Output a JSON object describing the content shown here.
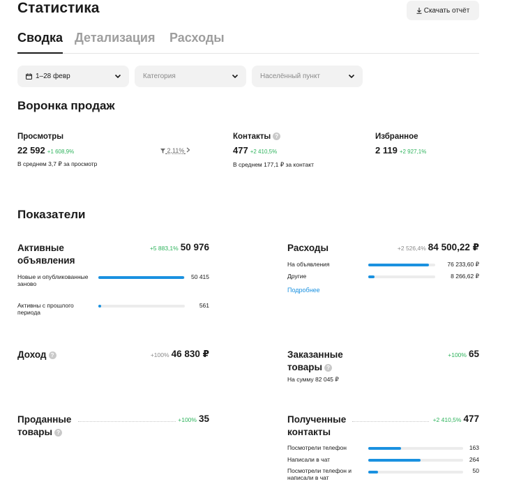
{
  "header": {
    "title": "Статистика",
    "download_label": "Скачать отчёт"
  },
  "tabs": [
    {
      "label": "Сводка",
      "active": true
    },
    {
      "label": "Детализация",
      "active": false
    },
    {
      "label": "Расходы",
      "active": false
    }
  ],
  "filters": {
    "period": "1–28 февр",
    "category_placeholder": "Категория",
    "locality_placeholder": "Населённый пункт"
  },
  "funnel": {
    "title": "Воронка продаж",
    "views": {
      "label": "Просмотры",
      "value": "22 592",
      "delta": "+1 608,9%",
      "sub": "В среднем 3,7 ₽ за просмотр"
    },
    "conversion": "2,11%",
    "contacts": {
      "label": "Контакты",
      "value": "477",
      "delta": "+2 410,5%",
      "sub": "В среднем 177,1 ₽ за контакт"
    },
    "favorites": {
      "label": "Избранное",
      "value": "2 119",
      "delta": "+2 927,1%"
    }
  },
  "indicators": {
    "title": "Показатели",
    "active_ads": {
      "title": "Активные объявления",
      "pct": "+5 883,1%",
      "value": "50 976",
      "rows": [
        {
          "label": "Новые и опубликованные заново",
          "value": "50 415",
          "fraction": 0.989
        },
        {
          "label": "Активны с прошлого периода",
          "value": "561",
          "fraction": 0.011
        }
      ]
    },
    "expenses": {
      "title": "Расходы",
      "pct": "+2 526,4%",
      "value": "84 500,22 ₽",
      "rows": [
        {
          "label": "На объявления",
          "value": "76 233,60 ₽",
          "fraction": 0.902
        },
        {
          "label": "Другие",
          "value": "8 266,62 ₽",
          "fraction": 0.098
        }
      ],
      "more_link": "Подробнее"
    },
    "income": {
      "title": "Доход",
      "pct": "+100%",
      "value": "46 830 ₽"
    },
    "ordered": {
      "title": "Заказанные товары",
      "pct": "+100%",
      "value": "65",
      "note": "На сумму 82 045 ₽"
    },
    "sold": {
      "title": "Проданные товары",
      "pct": "+100%",
      "value": "35"
    },
    "received_contacts": {
      "title": "Полученные контакты",
      "pct": "+2 410,5%",
      "value": "477",
      "rows": [
        {
          "label": "Посмотрели телефон",
          "value": "163",
          "fraction": 0.342
        },
        {
          "label": "Написали в чат",
          "value": "264",
          "fraction": 0.553
        },
        {
          "label": "Посмотрели телефон и написали в чат",
          "value": "50",
          "fraction": 0.105
        }
      ]
    }
  }
}
